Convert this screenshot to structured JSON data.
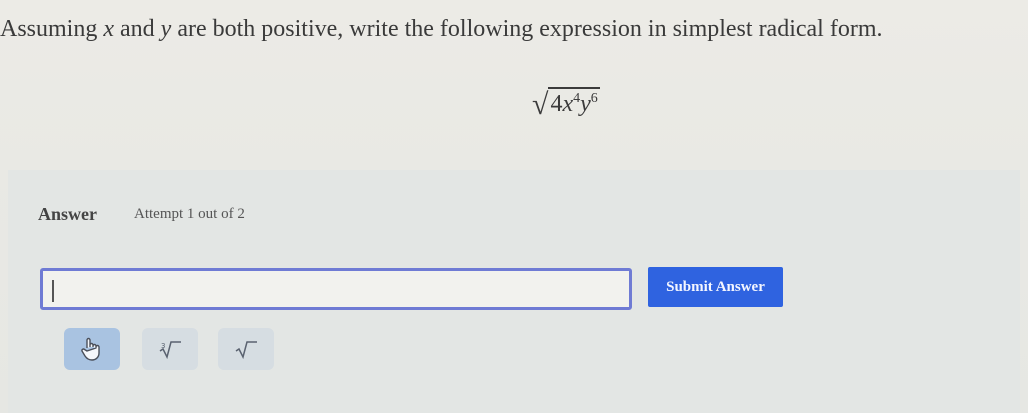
{
  "question": {
    "prefix": "Assuming ",
    "var_x": "x",
    "and": " and ",
    "var_y": "y",
    "suffix": " are both positive, write the following expression in simplest radical form."
  },
  "expression": {
    "radical": "√",
    "coef": "4",
    "var_x": "x",
    "exp_x": "4",
    "var_y": "y",
    "exp_y": "6"
  },
  "answer": {
    "label": "Answer",
    "attempt": "Attempt 1 out of 2",
    "input_value": "",
    "submit_label": "Submit Answer"
  },
  "tools": [
    {
      "icon": "hand-pointer-icon"
    },
    {
      "icon": "cube-root-icon"
    },
    {
      "icon": "square-root-icon"
    }
  ],
  "colors": {
    "accent": "#2f63e0",
    "input_border": "#6f7bd4",
    "active_tool": "#a9c3e1",
    "tool": "#d6dde2"
  }
}
